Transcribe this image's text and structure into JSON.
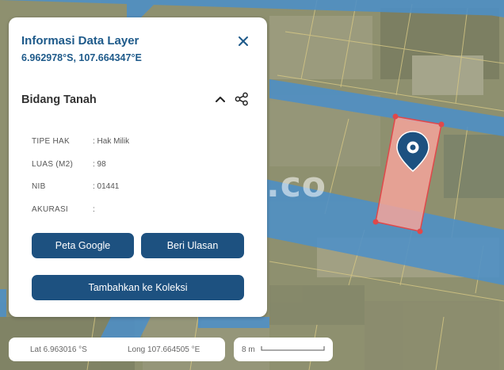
{
  "map": {
    "watermark": ".co",
    "colors": {
      "road": "#4d8fc7",
      "parcel_fill": "#f5a59b",
      "parcel_stroke": "#e0484a",
      "marker": "#1d5180"
    },
    "marker_icon": "map-pin-icon"
  },
  "panel": {
    "title": "Informasi Data Layer",
    "coords": "6.962978°S, 107.664347°E",
    "close_icon": "close-icon",
    "section_title": "Bidang Tanah",
    "collapse_icon": "chevron-up-icon",
    "share_icon": "share-icon",
    "attributes": [
      {
        "key": "TIPE HAK",
        "value": ": Hak Milik"
      },
      {
        "key": "LUAS (M2)",
        "value": ": 98"
      },
      {
        "key": "NIB",
        "value": ": 01441"
      },
      {
        "key": "AKURASI",
        "value": ":"
      }
    ],
    "buttons": {
      "google_maps": "Peta Google",
      "review": "Beri Ulasan",
      "add_collection": "Tambahkan ke Koleksi"
    }
  },
  "status": {
    "lat": "Lat 6.963016 °S",
    "long": "Long 107.664505 °E"
  },
  "scale": {
    "label": "8 m"
  }
}
